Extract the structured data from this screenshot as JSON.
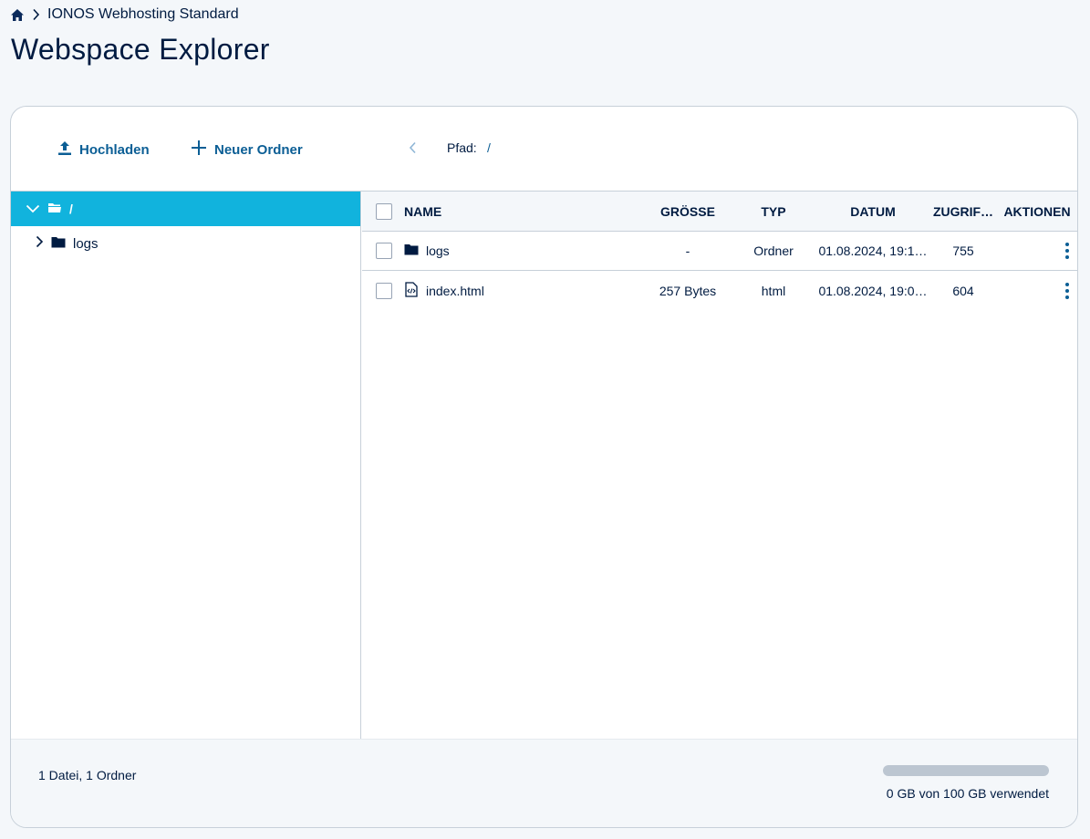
{
  "breadcrumb": {
    "home_icon": "home-icon",
    "separator_icon": "chevron-right-icon",
    "item": "IONOS Webhosting Standard"
  },
  "page": {
    "title": "Webspace Explorer"
  },
  "toolbar": {
    "upload_label": "Hochladen",
    "upload_icon": "upload-icon",
    "new_folder_label": "Neuer Ordner",
    "new_folder_icon": "plus-icon",
    "back_icon": "chevron-left-icon",
    "path_label": "Pfad:",
    "path_value": "/"
  },
  "tree": {
    "root": {
      "label": "/",
      "icon": "open-folder-icon",
      "expanded": true
    },
    "items": [
      {
        "label": "logs",
        "icon": "folder-icon",
        "expanded": false
      }
    ]
  },
  "table": {
    "headers": {
      "name": "NAME",
      "size": "GRÖSSE",
      "type": "TYP",
      "date": "DATUM",
      "access": "ZUGRIF…",
      "actions": "AKTIONEN"
    },
    "rows": [
      {
        "name": "logs",
        "icon": "folder-icon",
        "size": "-",
        "type": "Ordner",
        "date": "01.08.2024, 19:1…",
        "access": "755"
      },
      {
        "name": "index.html",
        "icon": "html-file-icon",
        "size": "257 Bytes",
        "type": "html",
        "date": "01.08.2024, 19:0…",
        "access": "604"
      }
    ]
  },
  "footer": {
    "summary": "1 Datei, 1 Ordner",
    "quota_text": "0 GB von 100 GB verwendet",
    "quota_used_fraction": 0
  },
  "colors": {
    "accent": "#0b5e95",
    "selected": "#11b3dd",
    "text": "#001b41",
    "background": "#f4f7fa"
  }
}
